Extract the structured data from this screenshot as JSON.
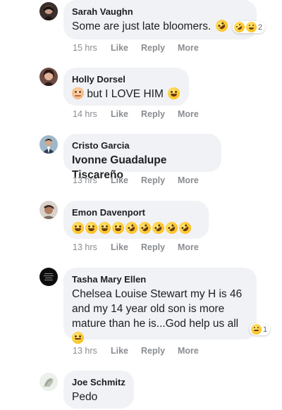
{
  "comments": [
    {
      "author": "Sarah Vaughn",
      "text": "Some are just late bloomers.",
      "emoji": [
        "rofl-emoji"
      ],
      "reaction": {
        "icons": [
          "rofl-emoji",
          "laughing-emoji"
        ],
        "count": "2"
      },
      "time": "15 hrs"
    },
    {
      "author": "Holly Dorsel",
      "text": "but I LOVE HIM",
      "leading_emoji": "person-gesturing-emoji",
      "emoji": [
        "smiling-eyes-emoji"
      ],
      "time": "14 hrs"
    },
    {
      "author": "Cristo Garcia",
      "text": "Ivonne Guadalupe Tiscareño",
      "time": "13 hrs"
    },
    {
      "author": "Emon Davenport",
      "emoji": [
        "laughing-emoji",
        "laughing-emoji",
        "laughing-emoji",
        "laughing-emoji",
        "rofl-emoji",
        "rofl-emoji",
        "rofl-emoji",
        "rofl-emoji",
        "rofl-emoji"
      ],
      "time": "13 hrs"
    },
    {
      "author": "Tasha Mary Ellen",
      "text": "Chelsea Louise Stewart my H is 46\nand my 14 year old son is more\nmature than he is...God help us all",
      "emoji": [
        "winking-emoji"
      ],
      "reaction": {
        "icons": [
          "sad-emoji"
        ],
        "count": "1"
      },
      "time": "13 hrs"
    },
    {
      "author": "Joe Schmitz",
      "text": "Pedo",
      "time": ""
    }
  ],
  "actions": {
    "like": "Like",
    "reply": "Reply",
    "more": "More"
  },
  "colors": {
    "bubble": "#f0f2f5",
    "meta": "#8a8d91",
    "text": "#1c1e21"
  }
}
